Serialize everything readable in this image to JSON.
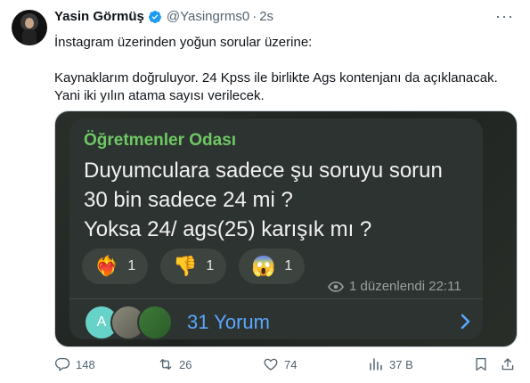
{
  "tweet": {
    "author_name": "Yasin Görmüş",
    "handle": "@Yasingrms0",
    "separator": "·",
    "time": "2s",
    "more_label": "···",
    "line1": "İnstagram üzerinden yoğun sorular üzerine:",
    "line2": "Kaynaklarım doğruluyor. 24 Kpss ile birlikte Ags kontenjanı da açıklanacak.",
    "line3": "Yani iki yılın atama sayısı verilecek."
  },
  "media": {
    "group_name": "Öğretmenler Odası",
    "message_lines": [
      "Duyumculara sadece şu soruyu sorun",
      "30 bin sadece 24 mi ?",
      "Yoksa 24/ ags(25) karışık mı ?"
    ],
    "reactions": [
      {
        "emoji": "❤️‍🔥",
        "icon": "heart-on-fire-icon",
        "count": "1"
      },
      {
        "emoji": "👎",
        "icon": "thumbs-down-icon",
        "count": "1"
      },
      {
        "emoji": "😱",
        "icon": "scream-face-icon",
        "count": "1"
      }
    ],
    "edited_text": "1 düzenlendi 22:11",
    "avatar_letter": "A",
    "comments_label": "31 Yorum"
  },
  "actions": {
    "replies": "148",
    "retweets": "26",
    "likes": "74",
    "views": "37 B"
  },
  "colors": {
    "verified": "#1d9bf0",
    "group_name": "#6ec864",
    "comments_link": "#5aa7ff",
    "muted": "#536471"
  }
}
